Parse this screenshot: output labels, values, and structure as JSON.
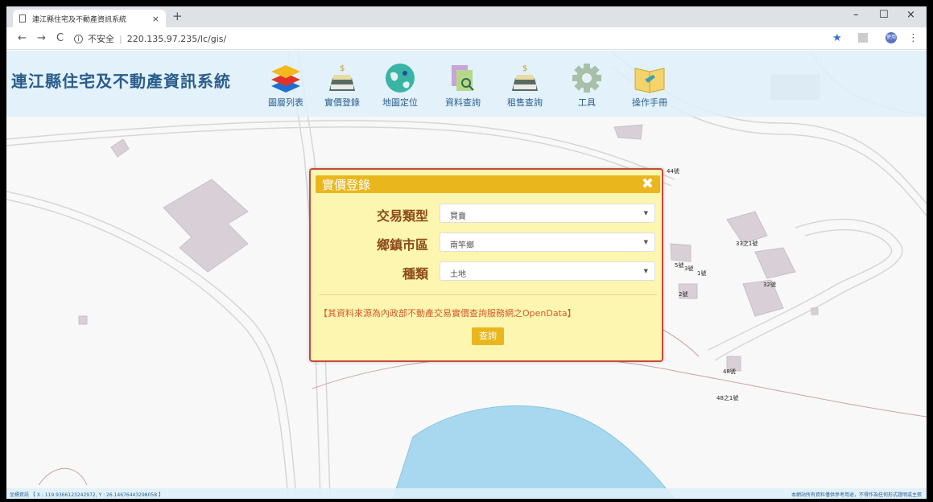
{
  "browser": {
    "tab_title": "連江縣住宅及不動產資訊系統",
    "tab_close": "×",
    "new_tab": "+",
    "window_controls": {
      "minimize": "–",
      "maximize": "☐",
      "close": "×"
    },
    "nav": {
      "back": "←",
      "forward": "→",
      "reload": "C"
    },
    "security_label": "不安全",
    "url": "220.135.97.235/lc/gis/",
    "profile_initials": "使用",
    "icons": [
      "bookmark-star-icon",
      "translate-icon",
      "profile-avatar",
      "menu-kebab-icon"
    ]
  },
  "header": {
    "site_title": "連江縣住宅及不動產資訊系統",
    "tools": [
      {
        "label": "圖層列表",
        "icon": "layers-icon"
      },
      {
        "label": "實價登錄",
        "icon": "price-tray-icon"
      },
      {
        "label": "地圖定位",
        "icon": "globe-locate-icon"
      },
      {
        "label": "資料查詢",
        "icon": "document-search-icon"
      },
      {
        "label": "租售查詢",
        "icon": "rent-tray-icon"
      },
      {
        "label": "工具",
        "icon": "gear-icon"
      },
      {
        "label": "操作手冊",
        "icon": "manual-book-icon"
      }
    ]
  },
  "dialog": {
    "title": "實價登錄",
    "close": "✖",
    "fields": [
      {
        "label": "交易類型",
        "value": "買賣"
      },
      {
        "label": "鄉鎮市區",
        "value": "南竿鄉"
      },
      {
        "label": "種類",
        "value": "土地"
      }
    ],
    "note": "【其資料來源為內政部不動產交易實價查詢服務網之OpenData】",
    "submit": "查詢"
  },
  "map_labels": [
    "44號",
    "33之1號",
    "5號",
    "3號",
    "1號",
    "32號",
    "2號",
    "48號",
    "48之1號"
  ],
  "status": {
    "coordinates": "坐標資訊 【 X : 119.9366123242972, Y : 26.14676443298058 】",
    "disclaimer": "本網站所有資料僅供參考用途，不得作為任何形式證明或主張"
  },
  "colors": {
    "header_bg": "#def0fa",
    "title_blue": "#2a5d8c",
    "dialog_bg": "#fdf6b0",
    "dialog_border": "#c64a3b",
    "dialog_accent": "#e9b71d",
    "field_label": "#8c4a1a",
    "note_text": "#d35a2a",
    "water": "#a8d8f0"
  }
}
